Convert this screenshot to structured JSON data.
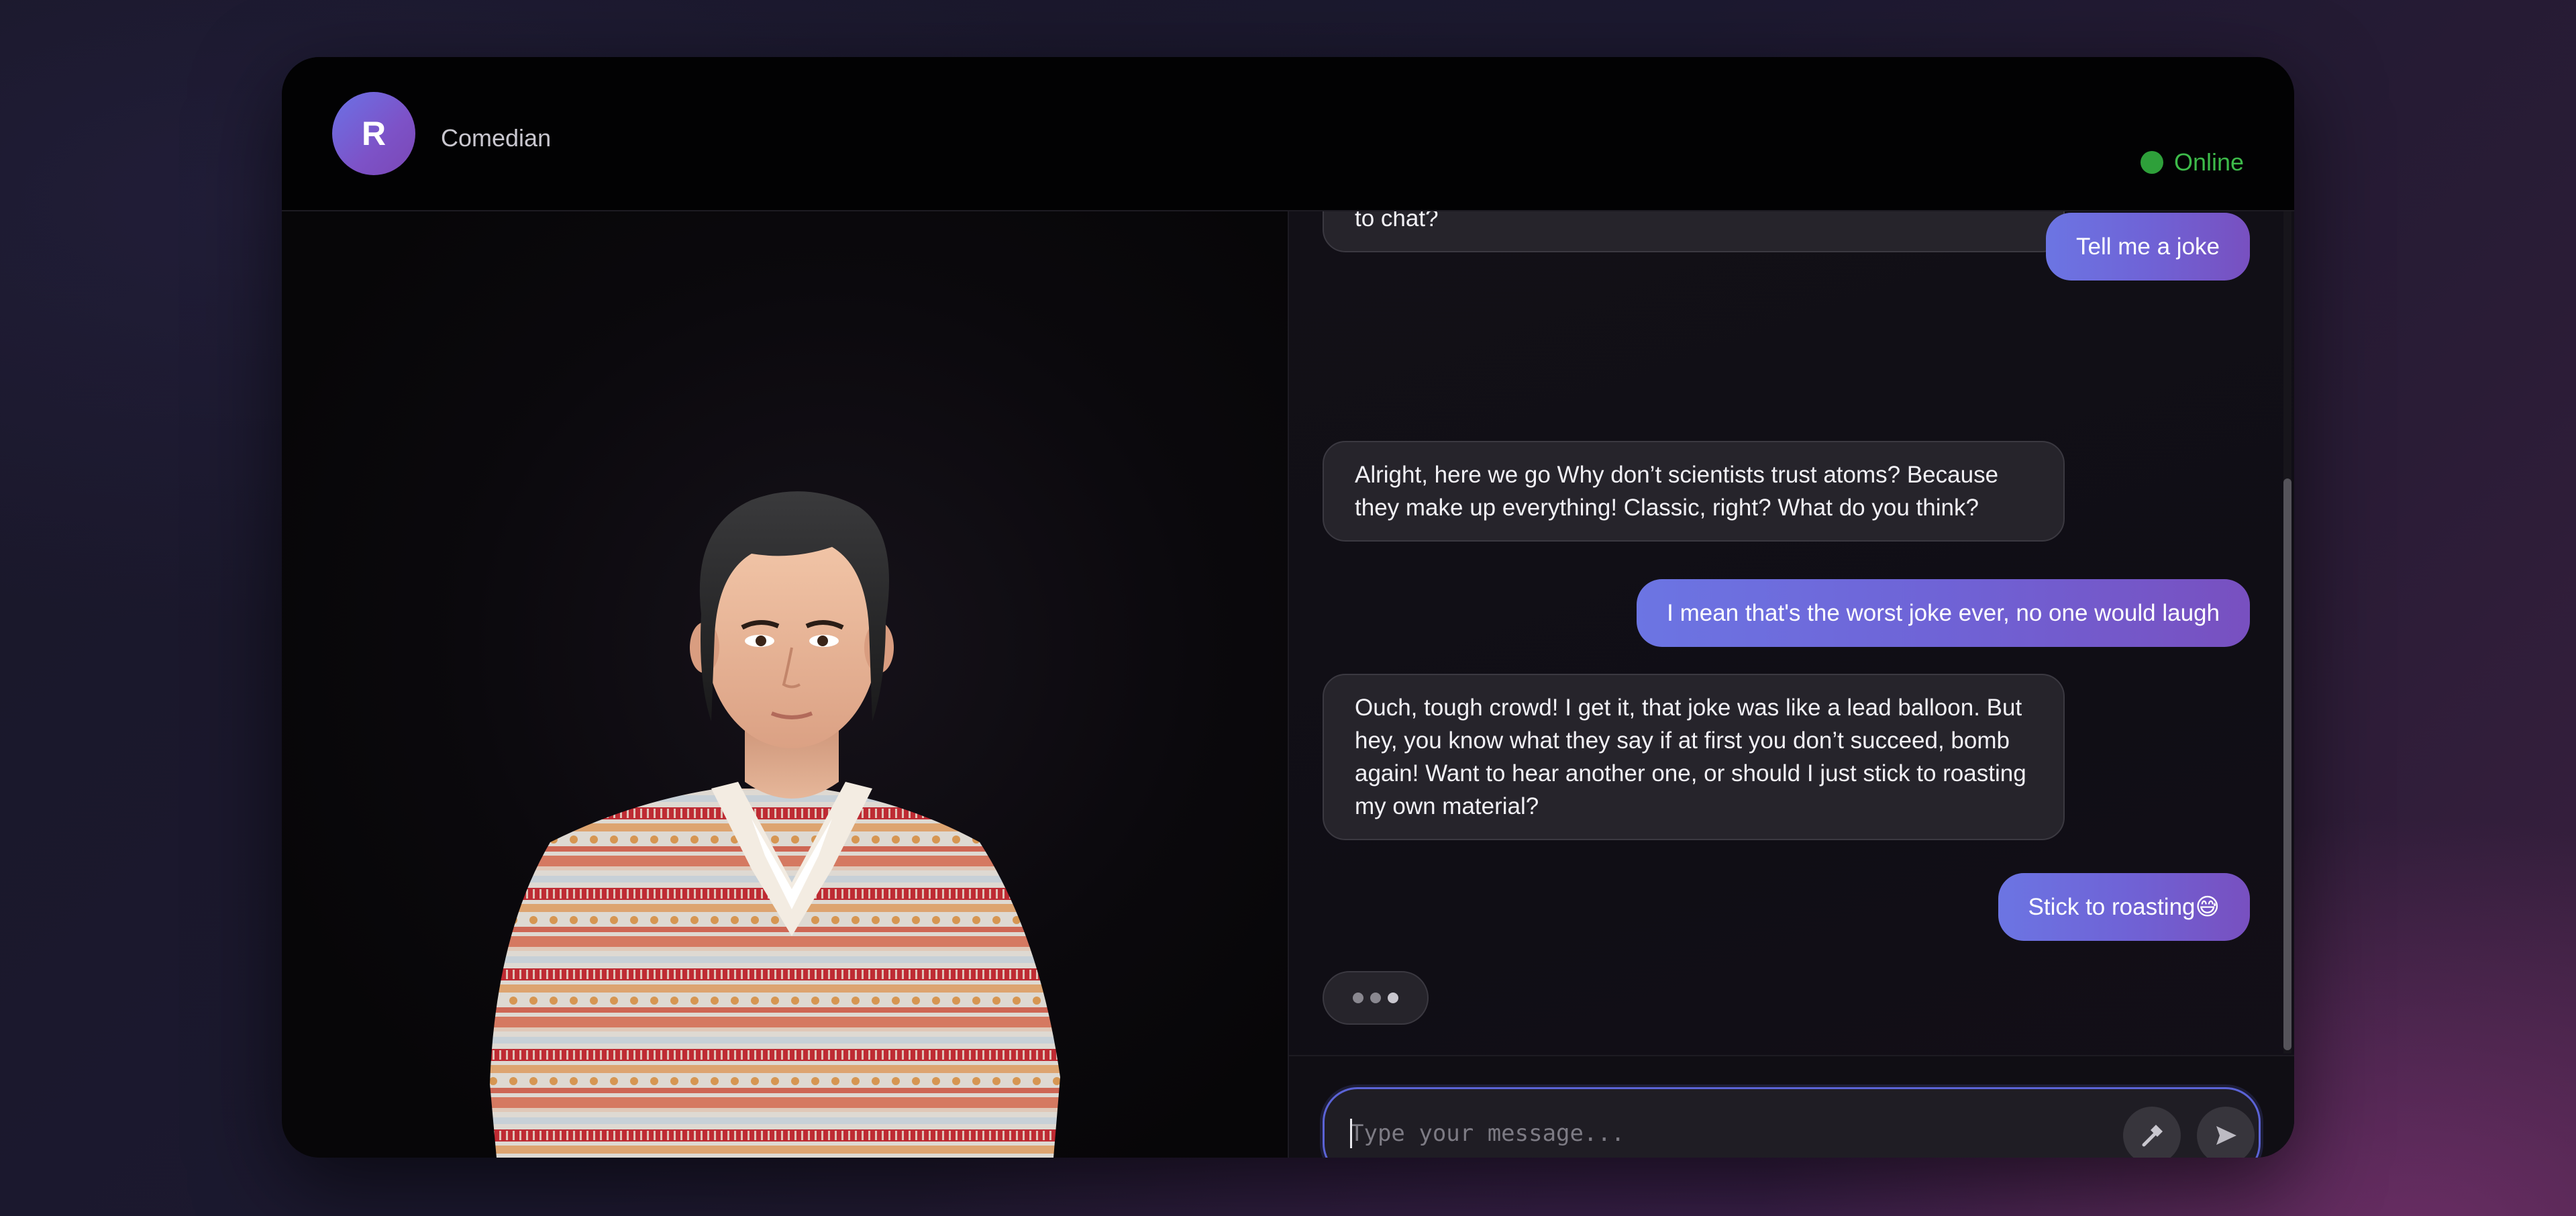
{
  "header": {
    "avatar_initial": "R",
    "character_name": "Comedian",
    "status_label": "Online"
  },
  "messages": [
    {
      "role": "ai",
      "text": "to chat?"
    },
    {
      "role": "user",
      "text": "Tell me a joke"
    },
    {
      "role": "ai",
      "text": "Alright, here we go Why don’t scientists trust atoms? Because they make up everything! Classic, right? What do you think?"
    },
    {
      "role": "user",
      "text": "I mean that's the worst joke ever, no one would laugh"
    },
    {
      "role": "ai",
      "text": "Ouch, tough crowd! I get it, that joke was like a lead balloon. But hey, you know what they say if at first you don’t succeed, bomb again! Want to hear another one, or should I just stick to roasting my own material?"
    },
    {
      "role": "user",
      "text": "Stick to roasting😅"
    }
  ],
  "typing_indicator": {
    "dots": 3
  },
  "input": {
    "placeholder": "Type your message...",
    "value": ""
  },
  "icons": {
    "tool_button": "hammer-icon",
    "send_button": "send-icon"
  },
  "colors": {
    "accent": "#6c75e3",
    "accent_end": "#7850c0",
    "online": "#3dbb4a",
    "panel": "#0c0a10",
    "bubble_ai": "#26242b"
  }
}
